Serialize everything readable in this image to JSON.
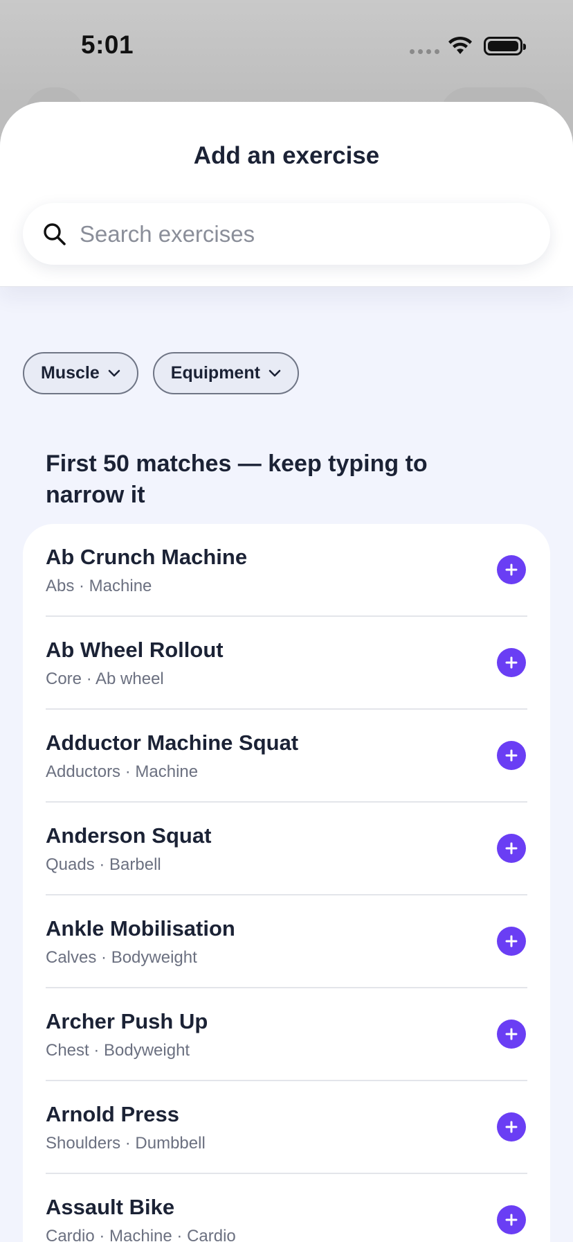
{
  "status_bar": {
    "time": "5:01"
  },
  "sheet": {
    "title": "Add an exercise",
    "search": {
      "placeholder": "Search exercises",
      "value": ""
    },
    "filters": [
      {
        "label": "Muscle"
      },
      {
        "label": "Equipment"
      }
    ],
    "section_title": "First 50 matches — keep typing to narrow it",
    "exercises": [
      {
        "name": "Ab Crunch Machine",
        "meta": "Abs · Machine"
      },
      {
        "name": "Ab Wheel Rollout",
        "meta": "Core · Ab wheel"
      },
      {
        "name": "Adductor Machine Squat",
        "meta": "Adductors · Machine"
      },
      {
        "name": "Anderson Squat",
        "meta": "Quads · Barbell"
      },
      {
        "name": "Ankle Mobilisation",
        "meta": "Calves · Bodyweight"
      },
      {
        "name": "Archer Push Up",
        "meta": "Chest · Bodyweight"
      },
      {
        "name": "Arnold Press",
        "meta": "Shoulders · Dumbbell"
      },
      {
        "name": "Assault Bike",
        "meta": "Cardio · Machine · Cardio"
      }
    ]
  },
  "colors": {
    "accent": "#6a3ef4",
    "text": "#1b2235",
    "muted": "#6b7080",
    "sheet_bg": "#f2f4fd"
  }
}
